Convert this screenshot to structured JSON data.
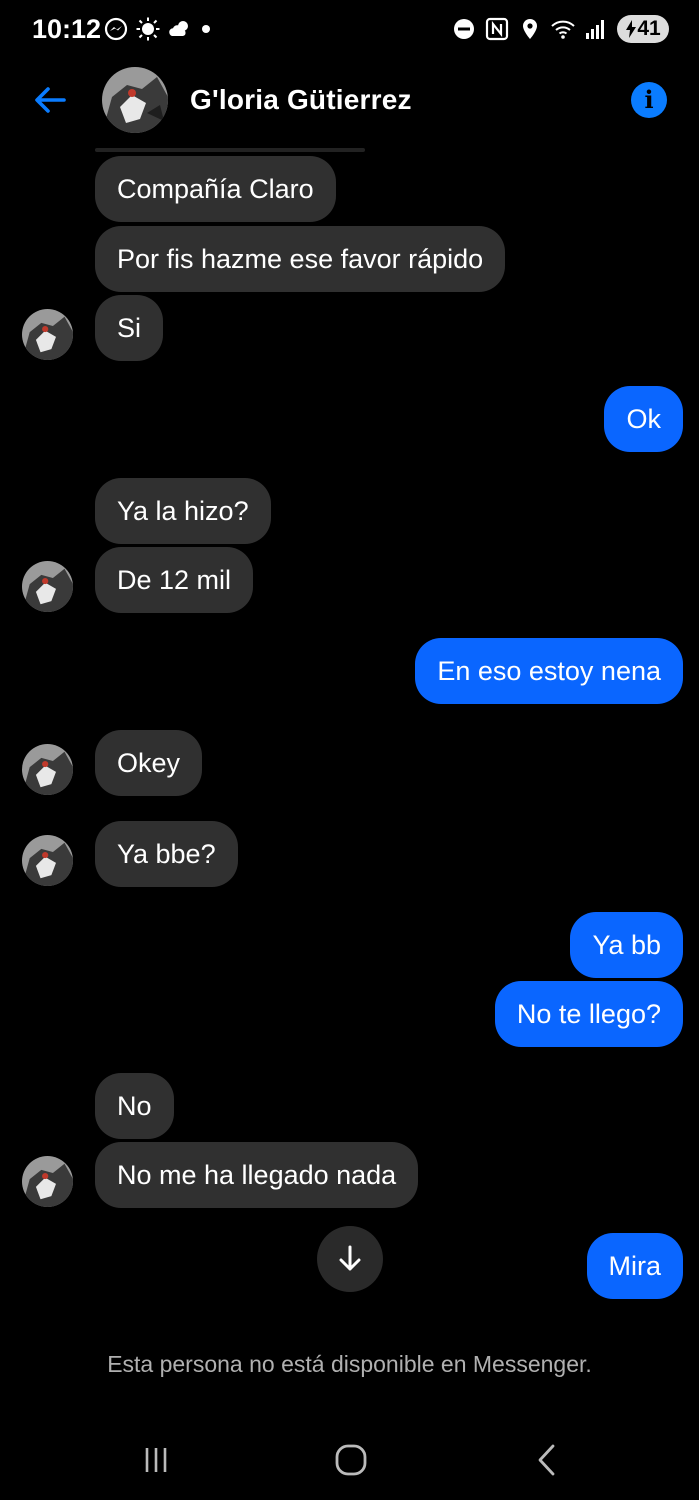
{
  "status_bar": {
    "time": "10:12",
    "battery": "41",
    "left_icons": [
      "messenger-icon",
      "brightness-icon",
      "weather-icon",
      "dot-icon"
    ],
    "right_icons": [
      "do-not-disturb-icon",
      "nfc-icon",
      "location-icon",
      "wifi-icon",
      "signal-icon"
    ]
  },
  "header": {
    "contact_name": "G'loria Gütierrez",
    "accent_color": "#0a7cff"
  },
  "messages": [
    {
      "side": "in",
      "text": "Compañía Claro"
    },
    {
      "side": "in",
      "text": "Por fis hazme ese favor rápido"
    },
    {
      "side": "in",
      "text": "Si"
    },
    {
      "side": "out",
      "text": "Ok"
    },
    {
      "side": "in",
      "text": "Ya la hizo?"
    },
    {
      "side": "in",
      "text": "De 12 mil"
    },
    {
      "side": "out",
      "text": "En eso estoy nena"
    },
    {
      "side": "in",
      "text": "Okey"
    },
    {
      "side": "in",
      "text": "Ya bbe?"
    },
    {
      "side": "out",
      "text": "Ya bb"
    },
    {
      "side": "out",
      "text": "No te llego?"
    },
    {
      "side": "in",
      "text": "No"
    },
    {
      "side": "in",
      "text": "No me ha llegado nada"
    },
    {
      "side": "out",
      "text": "Mira"
    }
  ],
  "colors": {
    "incoming_bubble": "#303030",
    "outgoing_bubble": "#0a66ff",
    "background": "#000000"
  },
  "footer": {
    "notice": "Esta persona no está disponible en Messenger."
  }
}
